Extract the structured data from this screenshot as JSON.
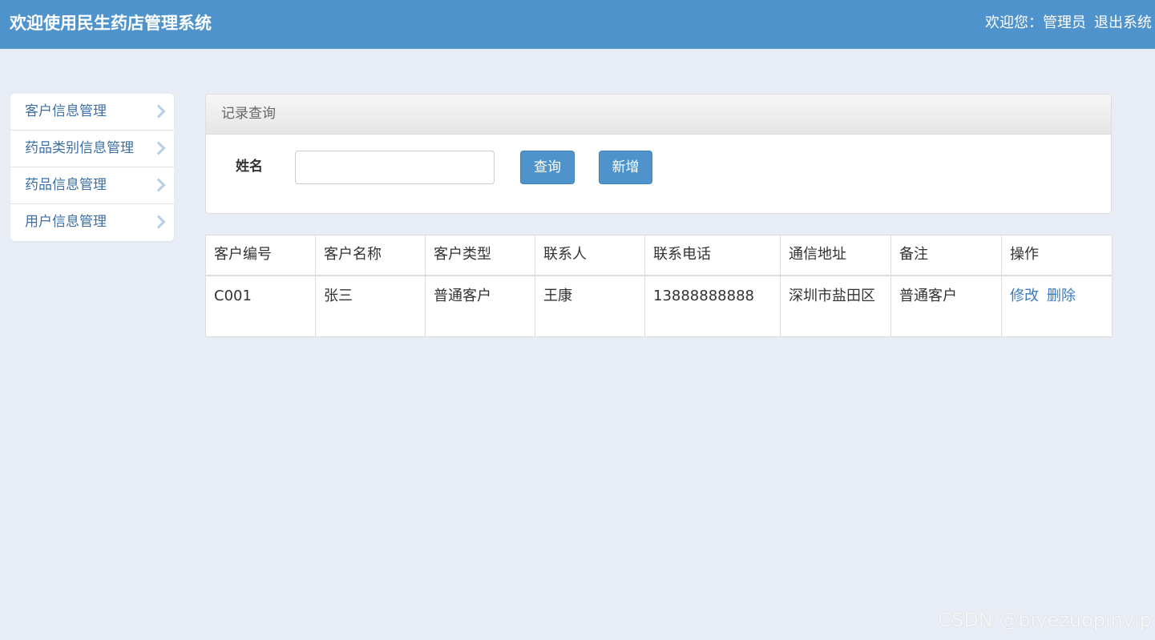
{
  "header": {
    "title": "欢迎使用民生药店管理系统",
    "welcome": "欢迎您：管理员",
    "logout": "退出系统"
  },
  "sidebar": {
    "items": [
      {
        "label": "客户信息管理",
        "icon": "chevron-right-icon"
      },
      {
        "label": "药品类别信息管理",
        "icon": "chevron-right-icon"
      },
      {
        "label": "药品信息管理",
        "icon": "chevron-right-icon"
      },
      {
        "label": "用户信息管理",
        "icon": "chevron-right-icon"
      }
    ]
  },
  "query": {
    "panel_title": "记录查询",
    "field_label": "姓名",
    "input_value": "",
    "search_label": "查询",
    "add_label": "新增"
  },
  "table": {
    "headers": [
      "客户编号",
      "客户名称",
      "客户类型",
      "联系人",
      "联系电话",
      "通信地址",
      "备注",
      "操作"
    ],
    "rows": [
      {
        "cells": [
          "C001",
          "张三",
          "普通客户",
          "王康",
          "13888888888",
          "深圳市盐田区",
          "普通客户"
        ],
        "edit_label": "修改",
        "delete_label": "删除"
      }
    ]
  },
  "watermark": "CSDN @biyezuopinvip",
  "colors": {
    "header_bg": "#4f93cd",
    "page_bg": "#e8ecf4",
    "link": "#3a7bbf"
  }
}
